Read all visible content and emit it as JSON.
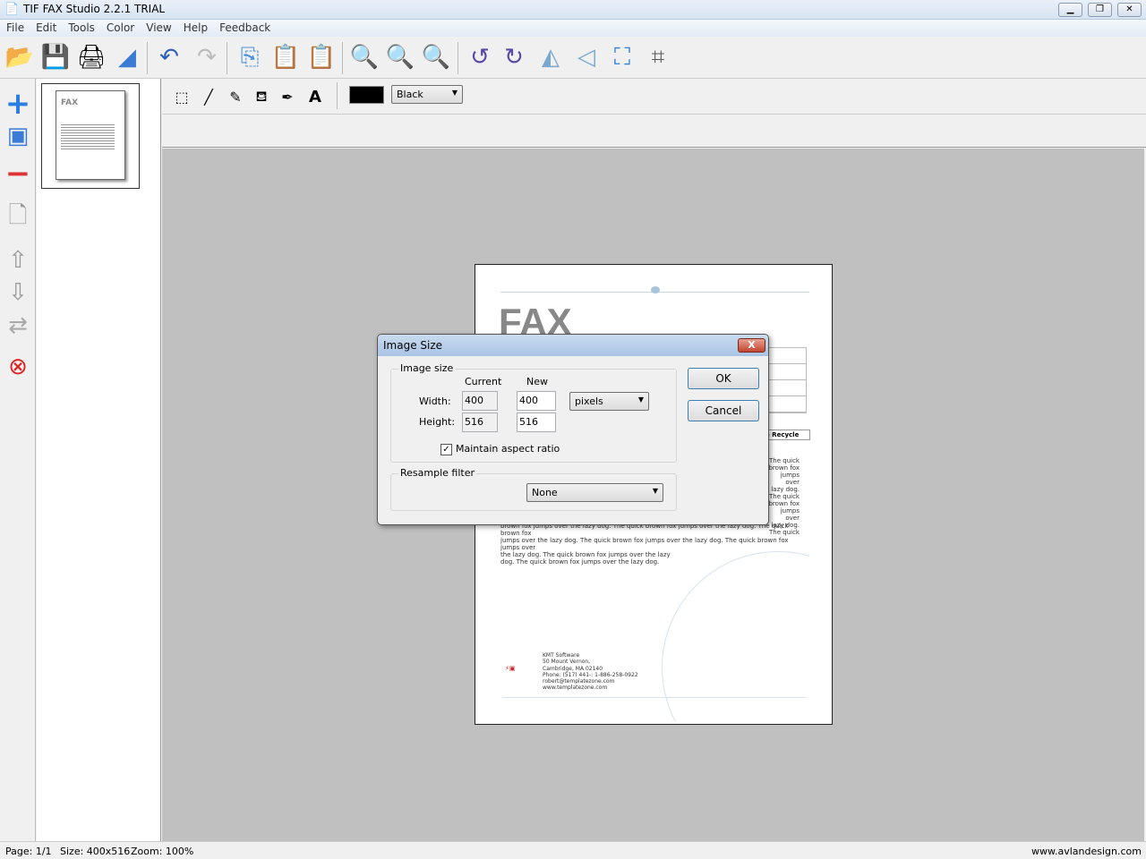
{
  "window": {
    "title": "TIF FAX Studio 2.2.1 TRIAL",
    "minimize": "▁",
    "restore": "❐",
    "close": "✕"
  },
  "menu": [
    "File",
    "Edit",
    "Tools",
    "Color",
    "View",
    "Help",
    "Feedback"
  ],
  "toolbar": {
    "icons": [
      "folder-open-icon",
      "save-icon",
      "print-icon",
      "scan-icon",
      "undo-icon",
      "redo-icon",
      "copy-icon",
      "paste-icon",
      "paste-special-icon",
      "zoom-out-icon",
      "zoom-actual-icon",
      "zoom-in-icon",
      "rotate-left-icon",
      "rotate-right-icon",
      "flip-horizontal-icon",
      "flip-vertical-icon",
      "fit-screen-icon",
      "crop-icon"
    ]
  },
  "left_tools": [
    "add-page-icon",
    "insert-image-icon",
    "remove-icon",
    "new-page-icon",
    "move-up-icon",
    "move-down-icon",
    "swap-icon",
    "delete-icon"
  ],
  "draw_toolbar": {
    "tools": [
      "rectangle-select-icon",
      "line-icon",
      "highlighter-icon",
      "fill-icon",
      "eyedropper-icon",
      "text-icon"
    ],
    "color": "#000000",
    "color_name": "Black",
    "text_glyph": "A"
  },
  "document": {
    "heading": "FAX",
    "recycle": "e Recycle",
    "body_right": [
      "The quick",
      "brown fox",
      "jumps over",
      "lazy dog.",
      "The quick",
      "brown fox",
      "jumps over",
      "lazy dog.",
      "The quick"
    ],
    "body_lines": [
      "brown fox jumps over the lazy dog. The quick brown fox jumps over the lazy dog. The quick brown fox",
      "jumps over the lazy dog. The quick brown fox jumps over the lazy dog. The quick brown fox jumps over",
      "the lazy dog. The quick brown fox jumps over the lazy",
      "dog. The quick brown fox jumps over the lazy dog."
    ],
    "address": [
      "KMT Software",
      "50 Mount Vernon,",
      "Cambridge, MA 02140",
      "Phone: (517) 441-: 1-886-258-0922",
      "robert@templatezone.com",
      "www.templatezone.com"
    ],
    "thumb_heading": "FAX"
  },
  "dialog": {
    "title": "Image Size",
    "close": "X",
    "image_size_label": "Image size",
    "current_label": "Current",
    "new_label": "New",
    "width_label": "Width:",
    "height_label": "Height:",
    "current_width": "400",
    "current_height": "516",
    "new_width": "400",
    "new_height": "516",
    "unit": "pixels",
    "maintain_aspect": "Maintain aspect ratio",
    "maintain_checked": true,
    "resample_label": "Resample filter",
    "resample_value": "None",
    "ok": "OK",
    "cancel": "Cancel"
  },
  "status": {
    "page": "Page: 1/1",
    "size": "Size: 400x516",
    "zoom": "Zoom: 100%",
    "website": "www.avlandesign.com"
  }
}
